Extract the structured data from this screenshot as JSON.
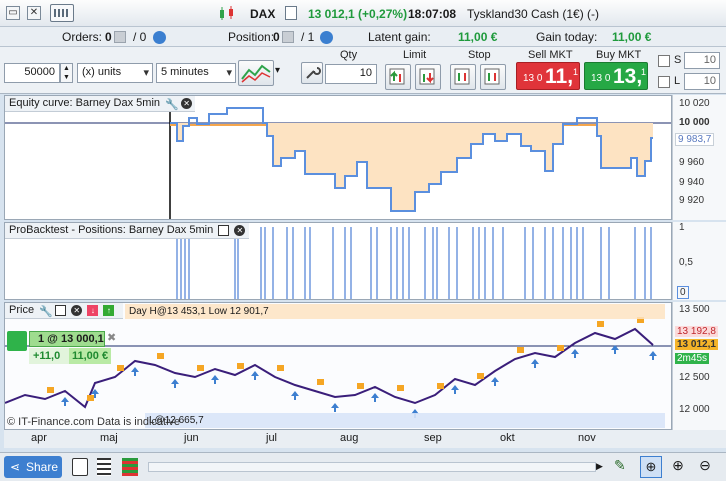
{
  "topbar": {
    "instrument": "DAX",
    "change": "13 012,1 (+0,27%)",
    "time": "18:07:08",
    "market": "Tyskland30 Cash (1€) (-)"
  },
  "infobar": {
    "orders_label": "Orders:",
    "orders_a": "0",
    "orders_b": "/ 0",
    "position_label": "Position:",
    "position_a": "0",
    "position_b": "/ 1",
    "latent_label": "Latent gain:",
    "latent_value": "11,00 €",
    "today_label": "Gain today:",
    "today_value": "11,00 €"
  },
  "orderbar": {
    "amount": "50000",
    "units": "(x) units",
    "timeframe": "5 minutes",
    "qty_label": "Qty",
    "qty": "10",
    "limit_label": "Limit",
    "stop_label": "Stop",
    "sell_label": "Sell MKT",
    "sell_small": "13 0",
    "sell_big": "11,",
    "sell_frac": "1",
    "buy_label": "Buy MKT",
    "buy_small": "13 0",
    "buy_big": "13,",
    "buy_frac": "1",
    "s_label": "S",
    "s_value": "10",
    "l_label": "L",
    "l_value": "10"
  },
  "equity": {
    "title": "Equity curve: Barney Dax 5min",
    "ticks": [
      "10 020",
      "10 000",
      "9 983,7",
      "9 960",
      "9 940",
      "9 920"
    ],
    "last": "9 983,7"
  },
  "positions": {
    "title": "ProBacktest - Positions: Barney Dax 5min",
    "ticks": [
      "1",
      "0,5",
      "0"
    ]
  },
  "price": {
    "title": "Price",
    "info": "Day  H@13 453,1   Low  12 901,7",
    "position_box": "1 @ 13 000,1",
    "pnl_points": "+11,0",
    "pnl_money": "11,00 €",
    "ticks": [
      "13 500",
      "13 192,8",
      "13 012,1",
      "12 500",
      "12 000"
    ],
    "countdown": "2m45s",
    "low_label": "L@12 665,7",
    "watermark": "© IT-Finance.com   Data is indicative",
    "months": [
      "apr",
      "maj",
      "jun",
      "jul",
      "aug",
      "sep",
      "okt",
      "nov"
    ]
  },
  "bottombar": {
    "share": "Share"
  },
  "colors": {
    "sell": "#e0343a",
    "buy": "#26a845",
    "equity_line": "#5b8fde",
    "equity_fill": "#fde3c2",
    "equity_below": "#f5a64c",
    "position_line": "#4d7fd4",
    "candle": "#3a1e7a"
  }
}
